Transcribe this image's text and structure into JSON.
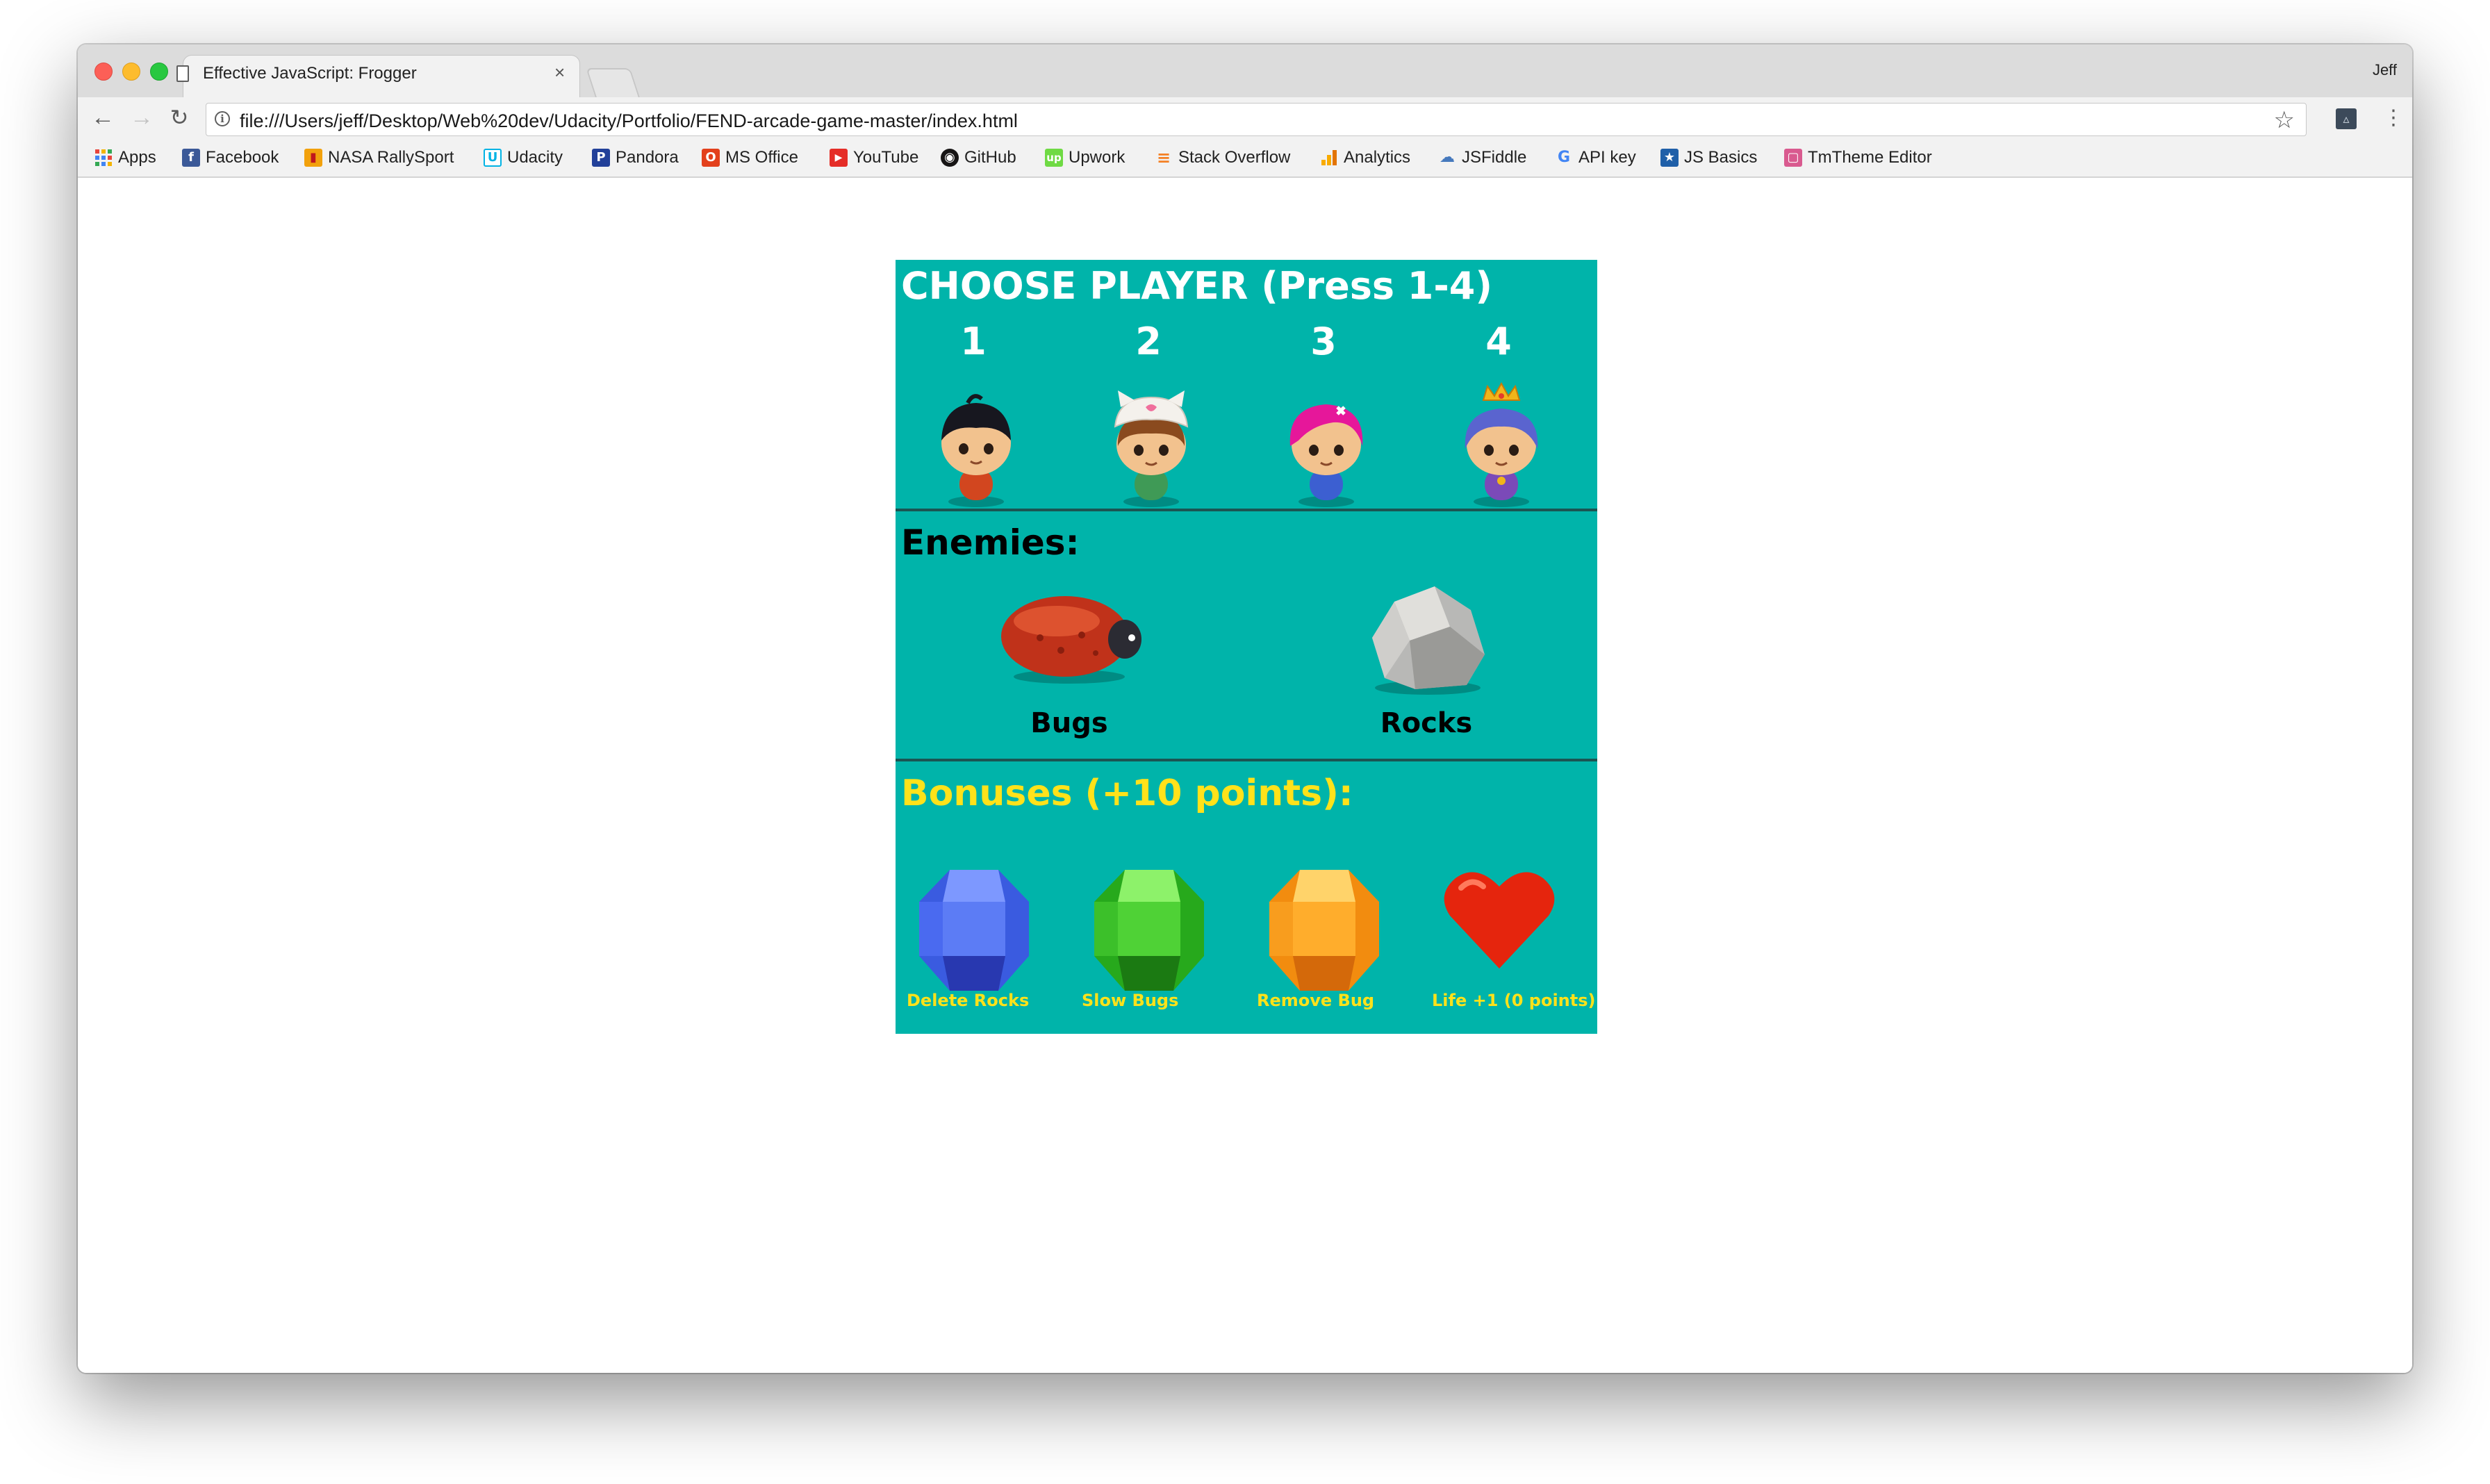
{
  "browser": {
    "tab_title": "Effective JavaScript: Frogger",
    "tab_close": "×",
    "profile_name": "Jeff",
    "url": "file:///Users/jeff/Desktop/Web%20dev/Udacity/Portfolio/FEND-arcade-game-master/index.html",
    "bookmarks": [
      {
        "label": "Apps",
        "icon": "apps-grid-icon"
      },
      {
        "label": "Facebook",
        "icon": "facebook-icon"
      },
      {
        "label": "NASA RallySport",
        "icon": "nasa-rallysport-icon"
      },
      {
        "label": "Udacity",
        "icon": "udacity-icon"
      },
      {
        "label": "Pandora",
        "icon": "pandora-icon"
      },
      {
        "label": "MS Office",
        "icon": "ms-office-icon"
      },
      {
        "label": "YouTube",
        "icon": "youtube-icon"
      },
      {
        "label": "GitHub",
        "icon": "github-icon"
      },
      {
        "label": "Upwork",
        "icon": "upwork-icon"
      },
      {
        "label": "Stack Overflow",
        "icon": "stack-overflow-icon"
      },
      {
        "label": "Analytics",
        "icon": "analytics-icon"
      },
      {
        "label": "JSFiddle",
        "icon": "jsfiddle-icon"
      },
      {
        "label": "API key",
        "icon": "google-icon"
      },
      {
        "label": "JS Basics",
        "icon": "js-basics-icon"
      },
      {
        "label": "TmTheme Editor",
        "icon": "tmtheme-editor-icon"
      }
    ]
  },
  "game": {
    "choose_heading": "CHOOSE PLAYER (Press 1-4)",
    "players": [
      {
        "number": "1",
        "sprite": "char-boy"
      },
      {
        "number": "2",
        "sprite": "char-cat-girl"
      },
      {
        "number": "3",
        "sprite": "char-pink-girl"
      },
      {
        "number": "4",
        "sprite": "char-princess-girl"
      }
    ],
    "enemies_heading": "Enemies:",
    "enemies": [
      {
        "label": "Bugs",
        "sprite": "enemy-bug"
      },
      {
        "label": "Rocks",
        "sprite": "rock"
      }
    ],
    "bonuses_heading": "Bonuses (+10 points):",
    "bonuses": [
      {
        "label": "Delete Rocks",
        "sprite": "gem-blue"
      },
      {
        "label": "Slow Bugs",
        "sprite": "gem-green"
      },
      {
        "label": "Remove Bug",
        "sprite": "gem-orange"
      },
      {
        "label": "Life +1 (0 points)",
        "sprite": "heart"
      }
    ],
    "colors": {
      "board": "#00b4aa",
      "bonus_text": "#ffe21a",
      "player_text": "#ffffff",
      "enemy_text": "#000000"
    }
  }
}
